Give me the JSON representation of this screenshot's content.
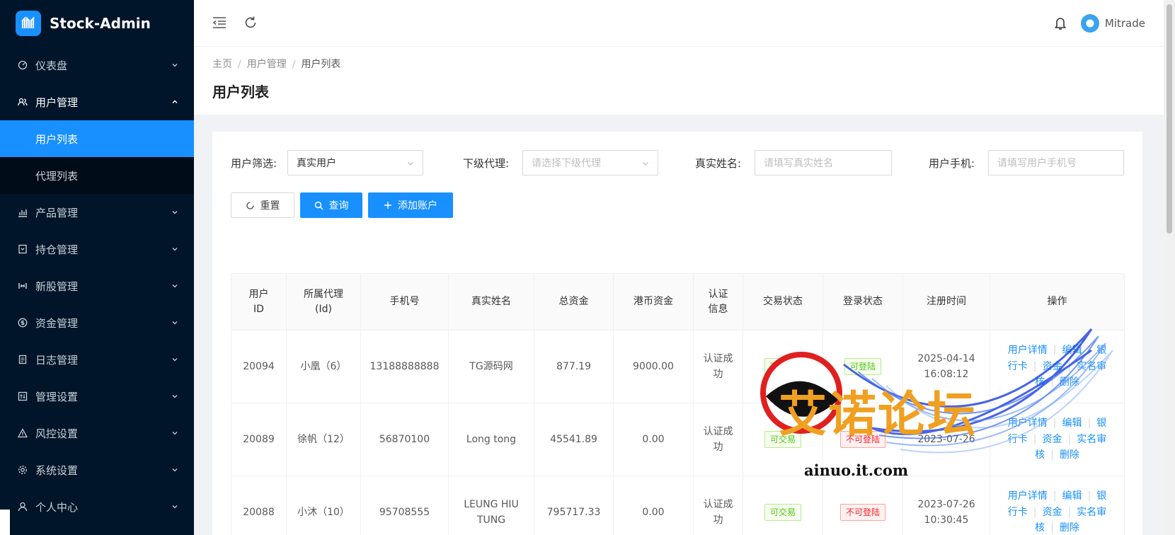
{
  "app": {
    "title": "Stock-Admin"
  },
  "sidebar": {
    "items": [
      {
        "label": "仪表盘",
        "icon": "dashboard-icon"
      },
      {
        "label": "用户管理",
        "icon": "users-icon",
        "open": true,
        "children": [
          {
            "label": "用户列表",
            "active": true
          },
          {
            "label": "代理列表"
          }
        ]
      },
      {
        "label": "产品管理",
        "icon": "chart-icon"
      },
      {
        "label": "持仓管理",
        "icon": "position-icon"
      },
      {
        "label": "新股管理",
        "icon": "ipo-icon"
      },
      {
        "label": "资金管理",
        "icon": "money-icon"
      },
      {
        "label": "日志管理",
        "icon": "log-icon"
      },
      {
        "label": "管理设置",
        "icon": "settings-panel-icon"
      },
      {
        "label": "风控设置",
        "icon": "warning-icon"
      },
      {
        "label": "系统设置",
        "icon": "gear-icon"
      },
      {
        "label": "个人中心",
        "icon": "user-icon"
      }
    ]
  },
  "header": {
    "username": "Mitrade"
  },
  "breadcrumb": [
    "主页",
    "用户管理",
    "用户列表"
  ],
  "page_title": "用户列表",
  "filters": {
    "user_filter_label": "用户筛选:",
    "user_filter_value": "真实用户",
    "agent_label": "下级代理:",
    "agent_placeholder": "请选择下级代理",
    "realname_label": "真实姓名:",
    "realname_placeholder": "请填写真实姓名",
    "phone_label": "用户手机:",
    "phone_placeholder": "请填写用户手机号"
  },
  "buttons": {
    "reset": "重置",
    "query": "查询",
    "add": "添加账户"
  },
  "table": {
    "headers": [
      "用户ID",
      "所属代理(Id)",
      "手机号",
      "真实姓名",
      "总资金",
      "港币资金",
      "认证信息",
      "交易状态",
      "登录状态",
      "注册时间",
      "操作"
    ],
    "headers_display": [
      [
        "用户",
        "ID"
      ],
      [
        "所属代理",
        "(Id)"
      ],
      [
        "手机号"
      ],
      [
        "真实姓名"
      ],
      [
        "总资金"
      ],
      [
        "港币资金"
      ],
      [
        "认证",
        "信息"
      ],
      [
        "交易状态"
      ],
      [
        "登录状态"
      ],
      [
        "注册时间"
      ],
      [
        "操作"
      ]
    ],
    "ops": [
      "用户详情",
      "编辑",
      "银行卡",
      "资金",
      "实名审核",
      "删除"
    ],
    "rows": [
      {
        "id": "20094",
        "agent": "小凰（6）",
        "phone": "13188888888",
        "name": "TG源码网",
        "total": "877.19",
        "hkd": "9000.00",
        "auth": "认证成功",
        "trade": "可交易",
        "trade_ok": true,
        "login": "可登陆",
        "login_ok": true,
        "date": "2025-04-14",
        "time": "16:08:12"
      },
      {
        "id": "20089",
        "agent": "徐帆（12）",
        "phone": "56870100",
        "name": "Long tong",
        "total": "45541.89",
        "hkd": "0.00",
        "auth": "认证成功",
        "trade": "可交易",
        "trade_ok": true,
        "login": "不可登陆",
        "login_ok": false,
        "date": "2023-07-26",
        "time": ""
      },
      {
        "id": "20088",
        "agent": "小沐（10）",
        "phone": "95708555",
        "name": "LEUNG HIU TUNG",
        "total": "795717.33",
        "hkd": "0.00",
        "auth": "认证成功",
        "trade": "可交易",
        "trade_ok": true,
        "login": "不可登陆",
        "login_ok": false,
        "date": "2023-07-26",
        "time": "10:30:45"
      }
    ]
  },
  "watermark": {
    "text": "艾诺论坛",
    "url": "ainuo.it.com"
  },
  "colors": {
    "sidebar_bg": "#001529",
    "primary": "#1890ff",
    "success": "#52c41a",
    "danger": "#f5222d"
  }
}
